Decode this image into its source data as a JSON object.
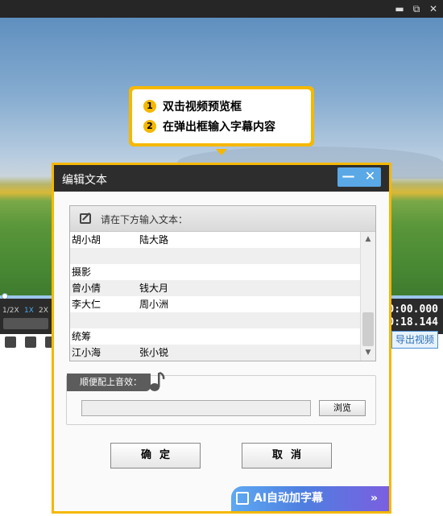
{
  "window": {
    "restore_glyph": "⧉",
    "close_glyph": "✕"
  },
  "callout": {
    "steps": [
      {
        "num": "1",
        "text": "双击视频预览框"
      },
      {
        "num": "2",
        "text": "在弹出框输入字幕内容"
      }
    ]
  },
  "player": {
    "speeds": [
      "1/2X",
      "1X",
      "2X"
    ],
    "active_speed": "1X",
    "time_current": "00:00.000",
    "time_total": "00:18.144",
    "export_label": "导出视频"
  },
  "dialog": {
    "title": "编辑文本",
    "minimize_glyph": "—",
    "close_glyph": "✕",
    "text_header": "请在下方输入文本：",
    "rows": [
      {
        "a": "胡小胡",
        "b": "陆大路"
      },
      {
        "a": "",
        "b": ""
      },
      {
        "a": "摄影",
        "b": ""
      },
      {
        "a": "曾小倩",
        "b": "钱大月"
      },
      {
        "a": "李大仁",
        "b": "周小洲"
      },
      {
        "a": "",
        "b": ""
      },
      {
        "a": "统筹",
        "b": ""
      },
      {
        "a": "江小海",
        "b": "张小锐"
      }
    ],
    "sound_label": "顺便配上音效：",
    "browse_label": "浏览",
    "ok_label": "确定",
    "cancel_label": "取消",
    "ai_label": "AI自动加字幕",
    "ai_arrow": "»"
  }
}
